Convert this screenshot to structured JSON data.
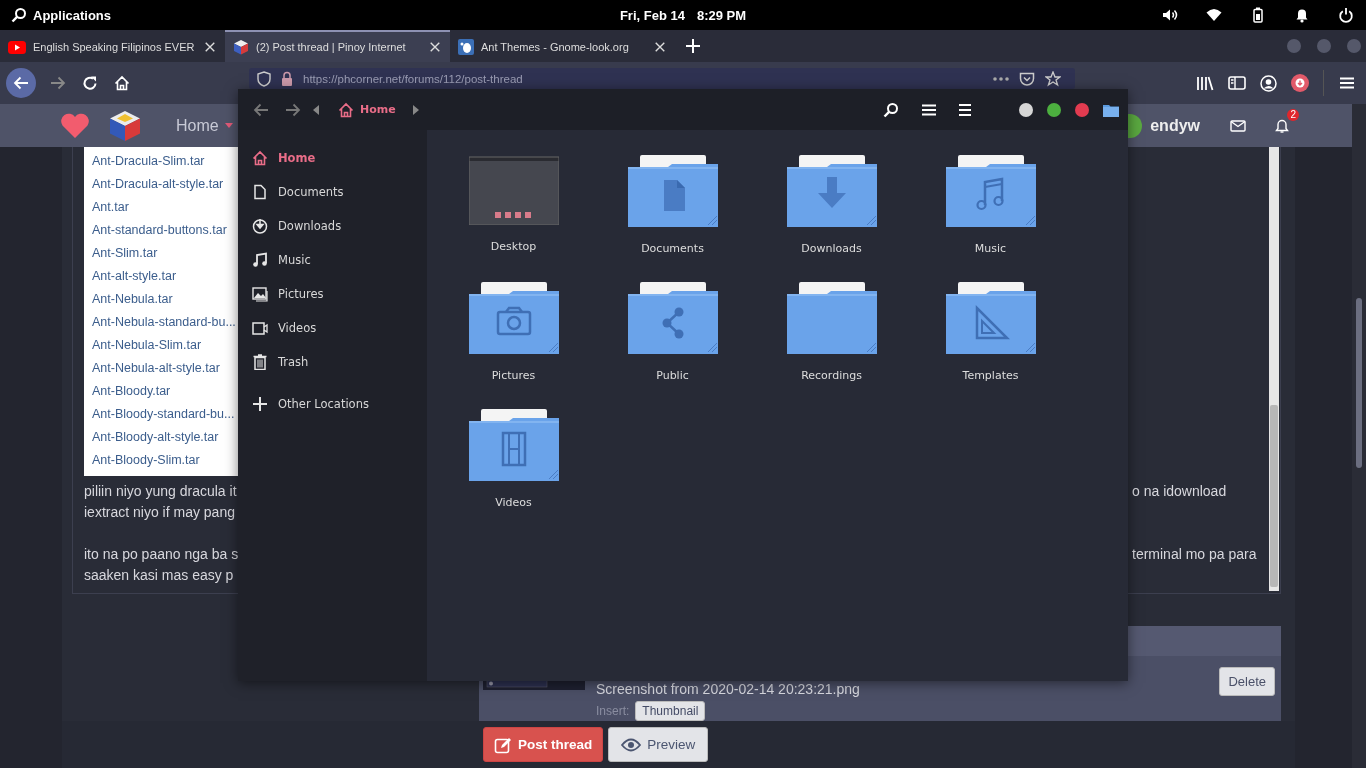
{
  "top_bar": {
    "menu": "Applications",
    "date": "Fri, Feb 14",
    "time": "8:29 PM"
  },
  "browser": {
    "tabs": [
      {
        "title": "English Speaking Filipinos EVER",
        "kind": "video",
        "selected": false
      },
      {
        "title": "(2) Post thread | Pinoy Internet",
        "kind": "cube",
        "selected": true
      },
      {
        "title": "Ant Themes - Gnome-look.org",
        "kind": "gnome",
        "selected": false
      }
    ],
    "url": "https://phcorner.net/forums/112/post-thread"
  },
  "site_header": {
    "nav_item": "Home",
    "username": "endyw",
    "notification_count": "2"
  },
  "post_editor": {
    "file_list": [
      "Ant-Dracula-Slim.tar",
      "Ant-Dracula-alt-style.tar",
      "Ant.tar",
      "Ant-standard-buttons.tar",
      "Ant-Slim.tar",
      "Ant-alt-style.tar",
      "Ant-Nebula.tar",
      "Ant-Nebula-standard-bu...",
      "Ant-Nebula-Slim.tar",
      "Ant-Nebula-alt-style.tar",
      "Ant-Bloody.tar",
      "Ant-Bloody-standard-bu...",
      "Ant-Bloody-alt-style.tar",
      "Ant-Bloody-Slim.tar"
    ],
    "paragraphs": [
      [
        {
          "left": "piliin niyo yung dracula it",
          "right": "o na idownload"
        },
        {
          "left": "iextract niyo if may pang"
        }
      ],
      [
        {
          "left": "ito na po paano nga ba s",
          "right": "terminal mo pa para"
        },
        {
          "left": "saaken kasi mas easy p"
        }
      ]
    ]
  },
  "attachment": {
    "file_name": "Screenshot from 2020-02-14 20:23:21.png",
    "delete": "Delete",
    "insert_label": "Insert:",
    "insert_button": "Thumbnail"
  },
  "actions": [
    {
      "label": "Post thread",
      "kind": "primary"
    },
    {
      "label": "Preview",
      "kind": "secondary"
    }
  ],
  "file_manager": {
    "path": "Home",
    "places": [
      {
        "label": "Home",
        "kind": "home",
        "selected": true
      },
      {
        "label": "Documents",
        "kind": "document",
        "selected": false
      },
      {
        "label": "Downloads",
        "kind": "download",
        "selected": false
      },
      {
        "label": "Music",
        "kind": "music",
        "selected": false
      },
      {
        "label": "Pictures",
        "kind": "pictures",
        "selected": false
      },
      {
        "label": "Videos",
        "kind": "video",
        "selected": false
      },
      {
        "label": "Trash",
        "kind": "trash",
        "selected": false
      },
      {
        "label": "Other Locations",
        "kind": "other",
        "selected": false
      }
    ],
    "items": [
      {
        "label": "Desktop",
        "kind": "desktop"
      },
      {
        "label": "Documents",
        "kind": "document"
      },
      {
        "label": "Downloads",
        "kind": "download"
      },
      {
        "label": "Music",
        "kind": "music"
      },
      {
        "label": "Pictures",
        "kind": "camera"
      },
      {
        "label": "Public",
        "kind": "share"
      },
      {
        "label": "Recordings",
        "kind": "plain"
      },
      {
        "label": "Templates",
        "kind": "template"
      },
      {
        "label": "Videos",
        "kind": "film"
      }
    ]
  }
}
